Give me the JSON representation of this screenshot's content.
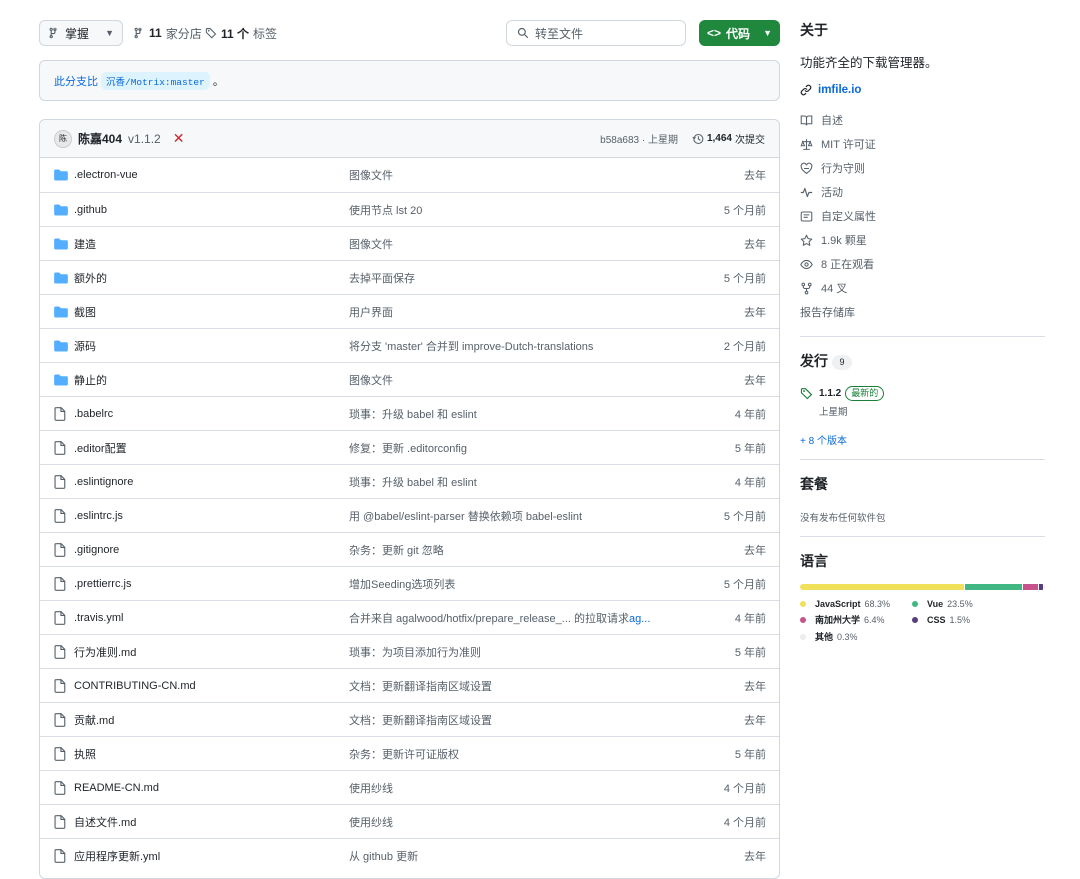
{
  "toolbar": {
    "branch": "掌握",
    "branches_count": "11",
    "branches_label": "家分店",
    "tags_count": "11 个",
    "tags_label": "标签",
    "goto_file_placeholder": "转至文件",
    "code_button": "代码"
  },
  "compare": {
    "prefix": "此分支",
    "link": "比",
    "ref": "沉香/Motrix:master",
    "suffix": "。"
  },
  "commit": {
    "avatar_text": "陈",
    "author": "陈嘉404",
    "version": "v1.1.2",
    "status": "✕",
    "hash_time": "b58a683 · 上星期",
    "commits_count": "1,464",
    "commits_label": "次提交"
  },
  "files": [
    {
      "type": "dir",
      "name": ".electron-vue",
      "message": "图像文件",
      "message_link": "",
      "time": "去年"
    },
    {
      "type": "dir",
      "name": ".github",
      "message": "使用节点 lst 20",
      "message_link": "",
      "time": "5 个月前"
    },
    {
      "type": "dir",
      "name": "建造",
      "message": "图像文件",
      "message_link": "",
      "time": "去年"
    },
    {
      "type": "dir",
      "name": "额外的",
      "message": "去掉平面保存",
      "message_link": "",
      "time": "5 个月前"
    },
    {
      "type": "dir",
      "name": "截图",
      "message": "用户界面",
      "message_link": "",
      "time": "去年"
    },
    {
      "type": "dir",
      "name": "源码",
      "message": "将分支 'master' 合并到 improve-Dutch-translations",
      "message_link": "",
      "time": "2 个月前"
    },
    {
      "type": "dir",
      "name": "静止的",
      "message": "图像文件",
      "message_link": "",
      "time": "去年"
    },
    {
      "type": "file",
      "name": ".babelrc",
      "message": "琐事：升级 babel 和 eslint",
      "message_link": "",
      "time": "4 年前"
    },
    {
      "type": "file",
      "name": ".editor配置",
      "message": "修复：更新 .editorconfig",
      "message_link": "",
      "time": "5 年前"
    },
    {
      "type": "file",
      "name": ".eslintignore",
      "message": "琐事：升级 babel 和 eslint",
      "message_link": "",
      "time": "4 年前"
    },
    {
      "type": "file",
      "name": ".eslintrc.js",
      "message": "用 @babel/eslint-parser 替换依赖项 babel-eslint",
      "message_link": "",
      "time": "5 个月前"
    },
    {
      "type": "file",
      "name": ".gitignore",
      "message": "杂务：更新 git 忽略",
      "message_link": "",
      "time": "去年"
    },
    {
      "type": "file",
      "name": ".prettierrc.js",
      "message": "增加Seeding选项列表",
      "message_link": "",
      "time": "5 个月前"
    },
    {
      "type": "file",
      "name": ".travis.yml",
      "message": "合并来自 agalwood/hotfix/prepare_release_... 的拉取请求",
      "message_link": "ag...",
      "time": "4 年前"
    },
    {
      "type": "file",
      "name": "行为准则.md",
      "message": "琐事：为项目添加行为准则",
      "message_link": "",
      "time": "5 年前"
    },
    {
      "type": "file",
      "name": "CONTRIBUTING-CN.md",
      "message": "文档：更新翻译指南区域设置",
      "message_link": "",
      "time": "去年"
    },
    {
      "type": "file",
      "name": "贡献.md",
      "message": "文档：更新翻译指南区域设置",
      "message_link": "",
      "time": "去年"
    },
    {
      "type": "file",
      "name": "执照",
      "message": "杂务：更新许可证版权",
      "message_link": "",
      "time": "5 年前"
    },
    {
      "type": "file",
      "name": "README-CN.md",
      "message": "使用纱线",
      "message_link": "",
      "time": "4 个月前"
    },
    {
      "type": "file",
      "name": "自述文件.md",
      "message": "使用纱线",
      "message_link": "",
      "time": "4 个月前"
    },
    {
      "type": "file",
      "name": "应用程序更新.yml",
      "message": "从 github 更新",
      "message_link": "",
      "time": "去年"
    }
  ],
  "sidebar": {
    "about_title": "关于",
    "description": "功能齐全的下载管理器。",
    "website": "imfile.io",
    "items": [
      {
        "icon": "book-icon",
        "label": "自述"
      },
      {
        "icon": "law-icon",
        "label": "MIT 许可证"
      },
      {
        "icon": "code-of-conduct-icon",
        "label": "行为守则"
      },
      {
        "icon": "pulse-icon",
        "label": "活动"
      },
      {
        "icon": "custom-properties-icon",
        "label": "自定义属性"
      },
      {
        "icon": "star-icon",
        "label": "1.9k 颗星"
      },
      {
        "icon": "eye-icon",
        "label": "8 正在观看"
      },
      {
        "icon": "fork-icon",
        "label": "44 叉"
      }
    ],
    "report": "报告存储库",
    "releases_title": "发行",
    "releases_count": "9",
    "release_tag": "1.1.2",
    "release_latest": "最新的",
    "release_date": "上星期",
    "more_releases": "+ 8 个版本",
    "packages_title": "套餐",
    "no_packages": "没有发布任何软件包",
    "languages_title": "语言",
    "languages": [
      {
        "name": "JavaScript",
        "percent": "68.3%",
        "value": 68.3,
        "color": "#f1e05a"
      },
      {
        "name": "Vue",
        "percent": "23.5%",
        "value": 23.5,
        "color": "#41b883"
      },
      {
        "name": "南加州大学",
        "percent": "6.4%",
        "value": 6.4,
        "color": "#c6538c"
      },
      {
        "name": "CSS",
        "percent": "1.5%",
        "value": 1.5,
        "color": "#563d7c"
      },
      {
        "name": "其他",
        "percent": "0.3%",
        "value": 0.3,
        "color": "#ededed"
      }
    ]
  }
}
